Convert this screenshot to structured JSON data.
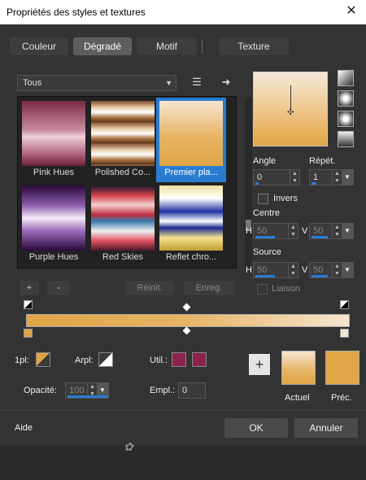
{
  "window": {
    "title": "Propriétés des styles et textures",
    "close_glyph": "✕"
  },
  "tabs": [
    "Couleur",
    "Dégradé",
    "Motif",
    "Texture"
  ],
  "active_tab": "Dégradé",
  "category_select": {
    "value": "Tous"
  },
  "gradients": [
    {
      "label": "Pink Hues",
      "selected": false
    },
    {
      "label": "Polished Co...",
      "selected": false
    },
    {
      "label": "Premier pla...",
      "selected": true
    },
    {
      "label": "Purple Hues",
      "selected": false
    },
    {
      "label": "Red Skies",
      "selected": false
    },
    {
      "label": "Reflet chro...",
      "selected": false
    }
  ],
  "library_buttons": {
    "add": "+",
    "remove": "-",
    "reset": "Réinit.",
    "save": "Enreg."
  },
  "angle": {
    "label": "Angle",
    "value": "0"
  },
  "repeat": {
    "label": "Répét.",
    "value": "1"
  },
  "invert": {
    "label": "Invers",
    "checked": false
  },
  "centre": {
    "label": "Centre",
    "h_label": "H",
    "h_value": "50",
    "v_label": "V",
    "v_value": "50"
  },
  "source": {
    "label": "Source",
    "h_label": "H",
    "h_value": "50",
    "v_label": "V",
    "v_value": "50"
  },
  "link": {
    "label": "Liaison",
    "checked": false
  },
  "stops": {
    "foreground_label": "1pl:",
    "background_label": "Arpl:",
    "user_label": "Util.:",
    "opacity_label": "Opacité:",
    "opacity_value": "100",
    "location_label": "Empl.:",
    "location_value": "0"
  },
  "swatches": {
    "current_label": "Actuel",
    "previous_label": "Préc.",
    "current_color": "#e7b466",
    "previous_color": "#e0a545",
    "user_color_1": "#8b2350",
    "user_color_2": "#8b2350"
  },
  "footer": {
    "help": "Aide",
    "ok": "OK",
    "cancel": "Annuler"
  }
}
